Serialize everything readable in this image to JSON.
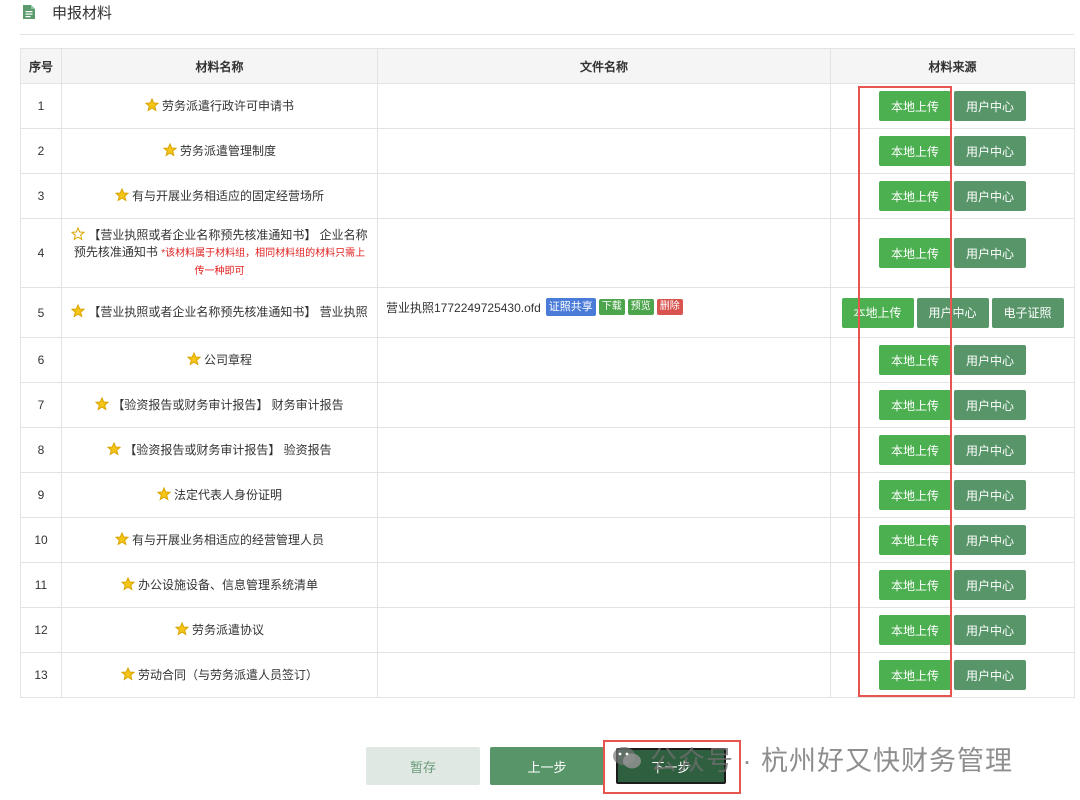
{
  "header": {
    "title": "申报材料"
  },
  "columns": [
    "序号",
    "材料名称",
    "文件名称",
    "材料来源"
  ],
  "rows": [
    {
      "seq": "1",
      "name": "劳务派遣行政许可申请书"
    },
    {
      "seq": "2",
      "name": "劳务派遣管理制度"
    },
    {
      "seq": "3",
      "name": "有与开展业务相适应的固定经营场所"
    },
    {
      "seq": "4",
      "name": "【营业执照或者企业名称预先核准通知书】 企业名称预先核准通知书",
      "note": "*该材料属于材料组，相同材料组的材料只需上传一种即可",
      "star_style": "outline"
    },
    {
      "seq": "5",
      "name": "【营业执照或者企业名称预先核准通知书】 营业执照",
      "file": "营业执照1772249725430.ofd",
      "has_ecert": true
    },
    {
      "seq": "6",
      "name": "公司章程"
    },
    {
      "seq": "7",
      "name": "【验资报告或财务审计报告】 财务审计报告"
    },
    {
      "seq": "8",
      "name": "【验资报告或财务审计报告】 验资报告"
    },
    {
      "seq": "9",
      "name": "法定代表人身份证明"
    },
    {
      "seq": "10",
      "name": "有与开展业务相适应的经营管理人员"
    },
    {
      "seq": "11",
      "name": "办公设施设备、信息管理系统清单"
    },
    {
      "seq": "12",
      "name": "劳务派遣协议"
    },
    {
      "seq": "13",
      "name": "劳动合同（与劳务派遣人员签订）"
    }
  ],
  "file_actions": {
    "share": "证照共享",
    "download": "下载",
    "preview": "预览",
    "delete": "删除"
  },
  "source_buttons": {
    "local": "本地上传",
    "user_center": "用户中心",
    "ecert": "电子证照"
  },
  "footer": {
    "save": "暂存",
    "prev": "上一步",
    "next": "下一步"
  },
  "watermark": {
    "text": "公众号 · 杭州好又快财务管理"
  },
  "colors": {
    "accent_green": "#4caf50",
    "muted_green": "#58966a",
    "dark_green": "#2e5f3e",
    "highlight_red": "#e8544e",
    "note_red": "#e02020",
    "share_blue": "#4a7bd8",
    "delete_red": "#d9534f",
    "star_fill": "#f5c518"
  },
  "icons": {
    "header": "document-icon",
    "row_marker": "star-icon",
    "watermark": "wechat-icon"
  }
}
